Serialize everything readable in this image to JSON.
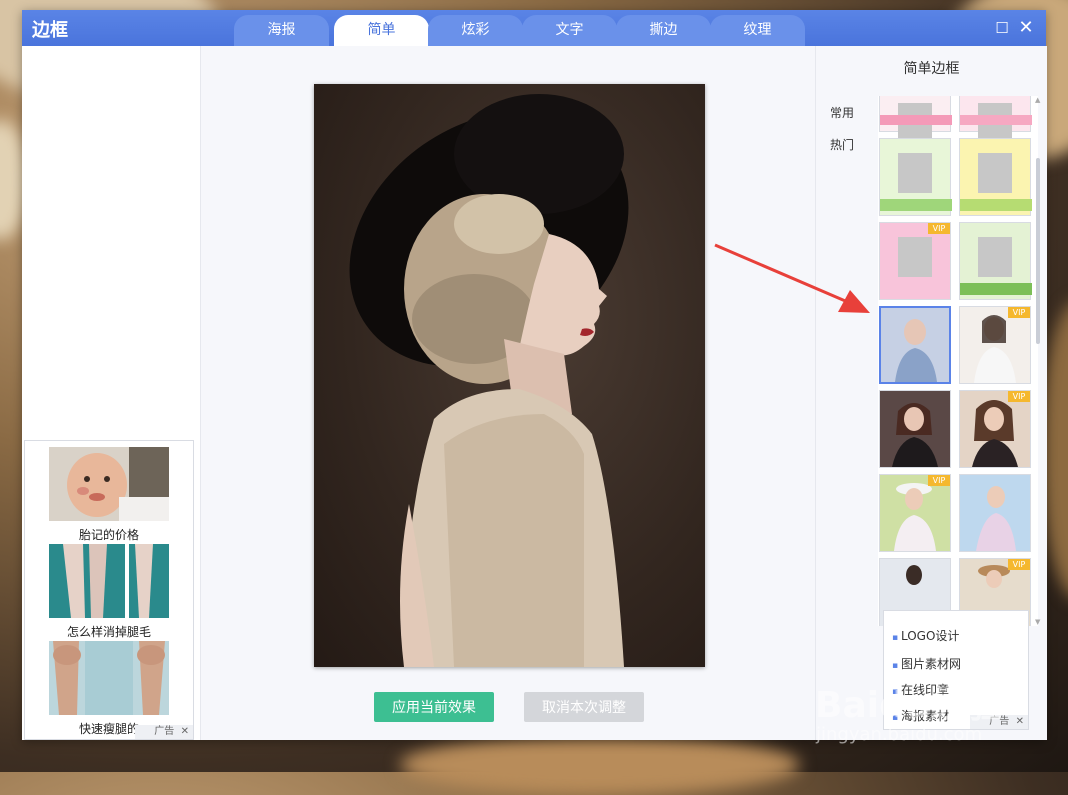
{
  "window": {
    "title": "边框"
  },
  "tabs": [
    {
      "label": "海报",
      "active": false
    },
    {
      "label": "简单",
      "active": true
    },
    {
      "label": "炫彩",
      "active": false
    },
    {
      "label": "文字",
      "active": false
    },
    {
      "label": "撕边",
      "active": false
    },
    {
      "label": "纹理",
      "active": false
    }
  ],
  "window_controls": {
    "maximize": "☐",
    "close": "✕"
  },
  "left_ad": {
    "items": [
      {
        "caption": "胎记的价格"
      },
      {
        "caption": "怎么样消掉腿毛"
      },
      {
        "caption": "快速瘦腿的"
      }
    ],
    "tag": "广告"
  },
  "actions": {
    "apply": "应用当前效果",
    "cancel": "取消本次调整"
  },
  "right_panel": {
    "title": "简单边框",
    "categories": [
      "常用",
      "热门"
    ],
    "vip_label": "VIP",
    "selected_thumb_index": 6
  },
  "right_ad": {
    "links": [
      "LOGO设计",
      "图片素材网",
      "在线印章",
      "海报素材"
    ],
    "tag": "广告"
  },
  "watermark": {
    "brand": "Baidu经验",
    "url": "jingyan.baidu.com"
  },
  "colors": {
    "accent": "#4a74dc",
    "apply_button": "#3dbf92",
    "cancel_button": "#d4d6da",
    "vip_badge": "#f5b82e",
    "arrow": "#e8403a"
  }
}
